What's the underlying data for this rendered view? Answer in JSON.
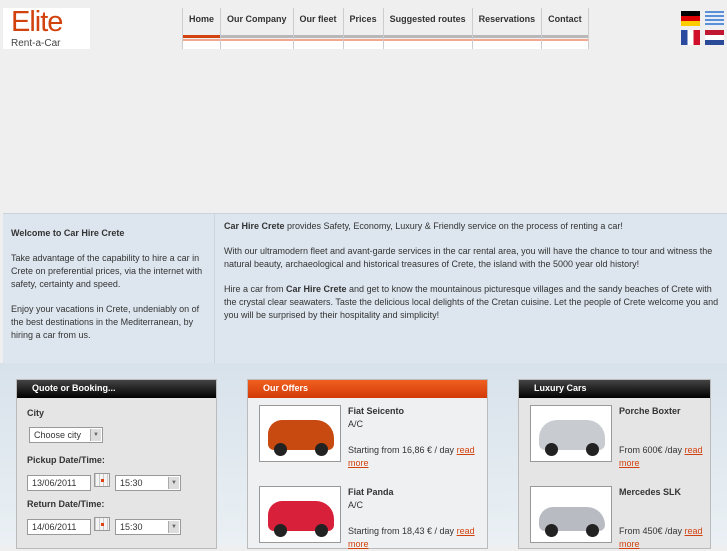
{
  "logo": {
    "title": "Elite",
    "subtitle": "Rent-a-Car"
  },
  "nav": [
    "Home",
    "Our Company",
    "Our fleet",
    "Prices",
    "Suggested routes",
    "Reservations",
    "Contact"
  ],
  "languages": [
    "German",
    "Greek",
    "French",
    "Dutch"
  ],
  "welcome": {
    "title": "Welcome to Car Hire Crete",
    "p1": "Take advantage of the capability to hire a car in Crete on preferential prices, via the internet with safety, certainty and speed.",
    "p2": "Enjoy your vacations in Crete, undeniably on of the best destinations in the Mediterranean, by hiring a car from us."
  },
  "intro": {
    "p1_bold": "Car Hire Crete",
    "p1": " provides Safety, Economy, Luxury & Friendly service on the process of renting a car!",
    "p2": "With our ultramodern fleet and avant-garde services in the car rental area, you will have the chance to tour and witness the natural beauty, archaeological and historical treasures of Crete, the island with the 5000 year old history!",
    "p3_a": "Hire a car from ",
    "p3_bold": "Car Hire Crete",
    "p3_b": " and get to know the mountainous picturesque villages and the sandy beaches of Crete with the crystal clear seawaters. Taste the delicious local delights of the Cretan cuisine. Let the people of Crete welcome you and you will be surprised by their hospitality and simplicity!"
  },
  "booking": {
    "title": "Quote or Booking...",
    "city_label": "City",
    "city_value": "Choose city",
    "pickup_label": "Pickup Date/Time:",
    "pickup_date": "13/06/2011",
    "pickup_time": "15:30",
    "return_label": "Return Date/Time:",
    "return_date": "14/06/2011",
    "return_time": "15:30"
  },
  "offers": {
    "title": "Our Offers",
    "items": [
      {
        "name": "Fiat Seicento",
        "ac": "A/C",
        "price": "Starting from 16,86 € / day",
        "link": "read more",
        "color": "#c84a10"
      },
      {
        "name": "Fiat Panda",
        "ac": "A/C",
        "price": "Starting from 18,43 € / day",
        "link": "read more",
        "color": "#d8203a"
      }
    ]
  },
  "luxury": {
    "title": "Luxury Cars",
    "items": [
      {
        "name": "Porche Boxter",
        "price": "From 600€ /day",
        "link": "read more",
        "color": "#c8ccd0"
      },
      {
        "name": "Mercedes SLK",
        "price": "From 450€ /day",
        "link": "read more",
        "color": "#b8bcc2"
      }
    ]
  }
}
